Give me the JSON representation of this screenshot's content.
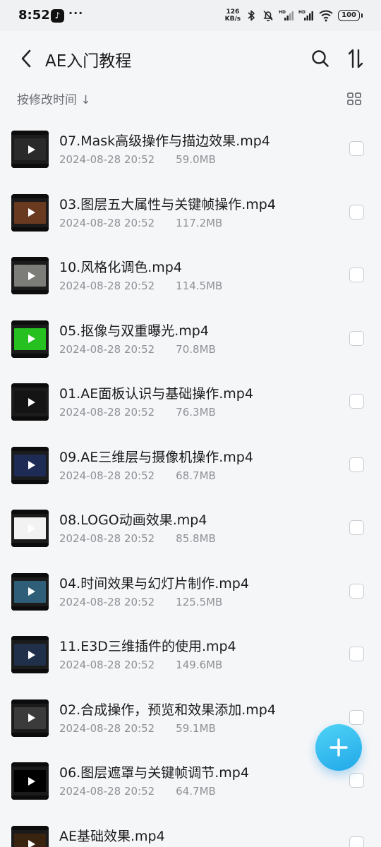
{
  "status": {
    "time": "8:52",
    "app_icon": "tiktok-icon",
    "dots": "···",
    "speed_value": "126",
    "speed_unit": "KB/s",
    "hd1": "HD",
    "hd2": "HD",
    "battery": "100"
  },
  "header": {
    "title": "AE入门教程",
    "back_icon": "back-arrow-icon",
    "search_icon": "search-icon",
    "sort_icon": "sort-icon"
  },
  "sortbar": {
    "label": "按修改时间 ↓",
    "view_icon": "grid-view-icon"
  },
  "files": [
    {
      "name": "07.Mask高级操作与描边效果.mp4",
      "date": "2024-08-28 20:52",
      "size": "59.0MB",
      "thumb": "#2a2a2a"
    },
    {
      "name": "03.图层五大属性与关键帧操作.mp4",
      "date": "2024-08-28 20:52",
      "size": "117.2MB",
      "thumb": "#6a3a20"
    },
    {
      "name": "10.风格化调色.mp4",
      "date": "2024-08-28 20:52",
      "size": "114.5MB",
      "thumb": "#7c7c78"
    },
    {
      "name": "05.抠像与双重曝光.mp4",
      "date": "2024-08-28 20:52",
      "size": "70.8MB",
      "thumb": "#27c021"
    },
    {
      "name": "01.AE面板认识与基础操作.mp4",
      "date": "2024-08-28 20:52",
      "size": "76.3MB",
      "thumb": "#141414"
    },
    {
      "name": "09.AE三维层与摄像机操作.mp4",
      "date": "2024-08-28 20:52",
      "size": "68.7MB",
      "thumb": "#1e2b55"
    },
    {
      "name": "08.LOGO动画效果.mp4",
      "date": "2024-08-28 20:52",
      "size": "85.8MB",
      "thumb": "#f2f2f2"
    },
    {
      "name": "04.时间效果与幻灯片制作.mp4",
      "date": "2024-08-28 20:52",
      "size": "125.5MB",
      "thumb": "#2f5f78"
    },
    {
      "name": "11.E3D三维插件的使用.mp4",
      "date": "2024-08-28 20:52",
      "size": "149.6MB",
      "thumb": "#20304a"
    },
    {
      "name": "02.合成操作，预览和效果添加.mp4",
      "date": "2024-08-28 20:52",
      "size": "59.1MB",
      "thumb": "#3b3b3b"
    },
    {
      "name": "06.图层遮罩与关键帧调节.mp4",
      "date": "2024-08-28 20:52",
      "size": "64.7MB",
      "thumb": "#000000"
    },
    {
      "name": "AE基础效果.mp4",
      "date": "",
      "size": "",
      "thumb": "#3a2410"
    }
  ],
  "fab": {
    "icon": "plus-icon"
  }
}
